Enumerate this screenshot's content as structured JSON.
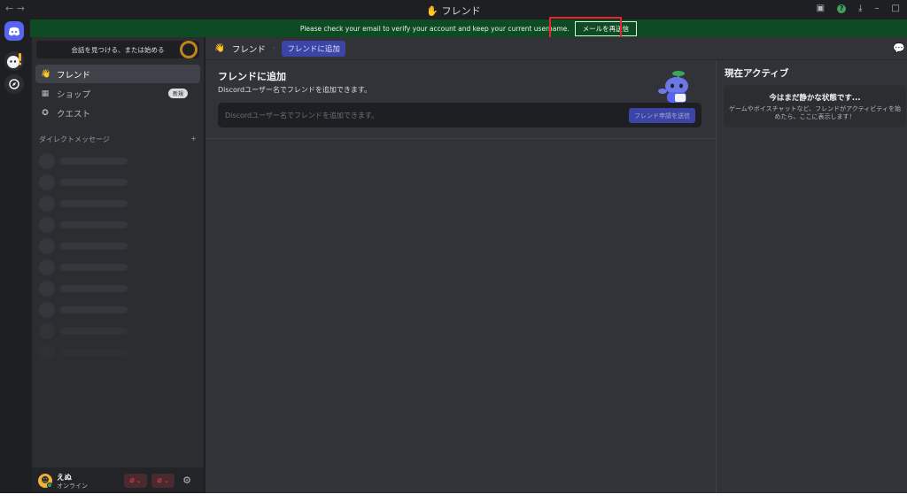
{
  "titlebar": {
    "back_arrows": "← →",
    "title_icon": "wave-hand-icon",
    "title": "フレンド",
    "controls": {
      "minimize": "–",
      "maximize": "□",
      "help": "?"
    }
  },
  "notice": {
    "message": "Please check your email to verify your account and keep your current username.",
    "button_label": "メールを再送信"
  },
  "sidebar": {
    "search_label": "会話を見つける、または始める",
    "items": [
      {
        "label": "フレンド",
        "icon": "friends-icon",
        "active": true
      },
      {
        "label": "ショップ",
        "icon": "shop-icon",
        "badge": "新規"
      },
      {
        "label": "クエスト",
        "icon": "quest-icon"
      }
    ],
    "dm_header": "ダイレクトメッセージ",
    "dm_add": "+"
  },
  "user": {
    "name": "えぬ",
    "status": "オンライン",
    "avatar_icon": "discord-avatar-icon"
  },
  "main": {
    "header_title": "フレンド",
    "header_separator": "·",
    "active_tab": "フレンドに追加"
  },
  "add_friend": {
    "title": "フレンドに追加",
    "description": "Discordユーザー名でフレンドを追加できます。",
    "input_placeholder": "Discordユーザー名でフレンドを追加できます。",
    "input_value": "",
    "button_label": "フレンド申請を送信"
  },
  "active_now": {
    "title": "現在アクティブ",
    "card_title": "今はまだ静かな状態です...",
    "card_description": "ゲームやボイスチャットなど、フレンドがアクティビティを始めたら、ここに表示します！"
  },
  "colors": {
    "brand": "#5865f2",
    "notice_bg": "#0e4a23",
    "highlight": "#e5252a",
    "online": "#23a55a",
    "danger": "#f23f43"
  }
}
